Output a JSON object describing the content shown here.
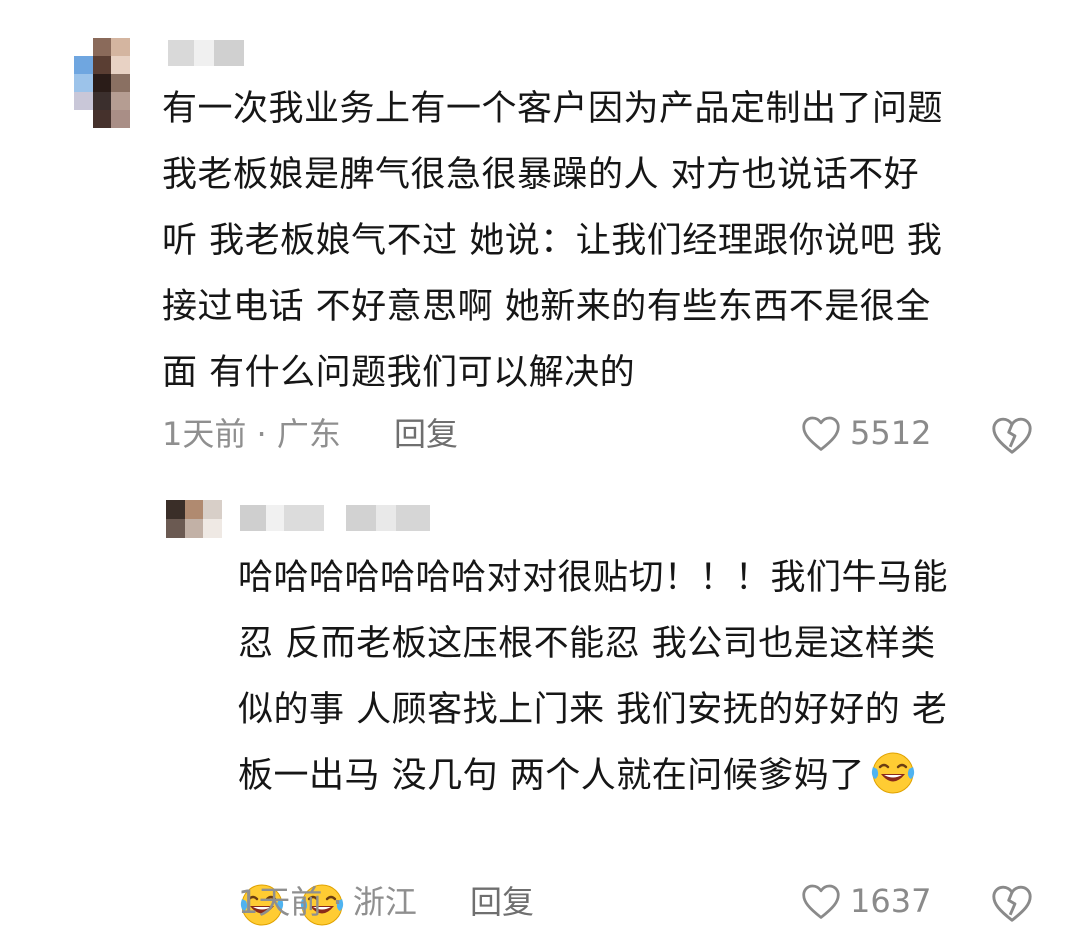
{
  "comment": {
    "text": "有一次我业务上有一个客户因为产品定制出了问题\n我老板娘是脾气很急很暴躁的人 对方也说话不好\n听 我老板娘气不过 她说：让我们经理跟你说吧 我\n接过电话 不好意思啊 她新来的有些东西不是很全\n面 有什么问题我们可以解决的",
    "time": "1天前",
    "location": "广东",
    "reply_label": "回复",
    "likes": "5512"
  },
  "reply": {
    "text": "哈哈哈哈哈哈哈对对很贴切！！！我们牛马能\n忍 反而老板这压根不能忍 我公司也是这样类\n似的事 人顾客找上门来 我们安抚的好好的 老\n板一出马 没几句 两个人就在问候爹妈了",
    "emojis": [
      "laughing-tears-emoji",
      "laughing-tears-emoji",
      "laughing-tears-emoji"
    ],
    "time": "1天前",
    "location": "浙江",
    "reply_label": "回复",
    "likes": "1637"
  },
  "colors": {
    "text": "#161616",
    "meta": "#8f8f8f",
    "icon": "#8a8a8a",
    "emoji_face": "#ffcc33"
  }
}
